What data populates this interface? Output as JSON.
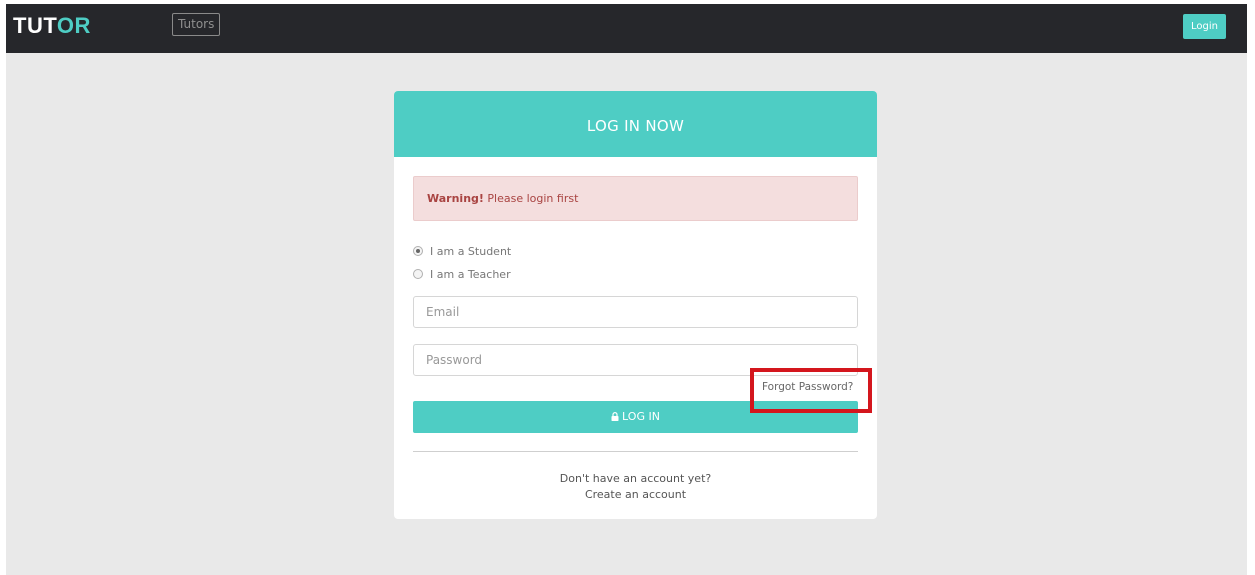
{
  "navbar": {
    "brand_main": "TUT",
    "brand_accent": "OR",
    "tutors_label": "Tutors",
    "login_label": "Login"
  },
  "card": {
    "title": "LOG IN NOW",
    "alert": {
      "strong": "Warning!",
      "text": " Please login first"
    },
    "roles": [
      {
        "label": "I am a Student",
        "checked": true
      },
      {
        "label": "I am a Teacher",
        "checked": false
      }
    ],
    "email_placeholder": "Email",
    "password_placeholder": "Password",
    "forgot_label": "Forgot Password?",
    "login_button_label": "LOG IN",
    "signup_prompt": "Don't have an account yet?",
    "signup_link": "Create an account"
  },
  "colors": {
    "accent": "#4ecdc4",
    "navbar": "#26272b",
    "alert_bg": "#f4dede",
    "alert_text": "#a94442",
    "highlight": "#d4161d"
  },
  "icons": {
    "login_button": "lock-icon"
  }
}
